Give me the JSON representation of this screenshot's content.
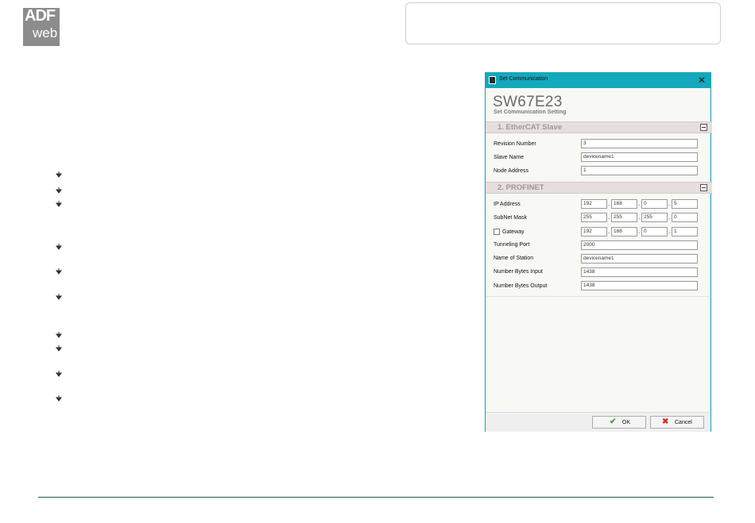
{
  "logo": {
    "line1": "ADF",
    "line2": "web"
  },
  "dialog": {
    "window_title": "Set Communication",
    "close_glyph": "✕",
    "heading": "SW67E23",
    "subheading": "Set Communication Setting",
    "sections": [
      {
        "label": "1. EtherCAT Slave",
        "toggle": "minus"
      },
      {
        "label": "2. PROFINET",
        "toggle": "minus"
      }
    ],
    "ethercat": {
      "revision_label": "Revision Number",
      "revision_value": "3",
      "slave_name_label": "Slave Name",
      "slave_name_value": "devicename1",
      "node_address_label": "Node Address",
      "node_address_value": "1"
    },
    "profinet": {
      "ip_label": "IP Address",
      "ip": [
        "192",
        "168",
        "0",
        "5"
      ],
      "subnet_label": "SubNet Mask",
      "subnet": [
        "255",
        "255",
        "255",
        "0"
      ],
      "gateway_label": "Gateway",
      "gateway_checked": false,
      "gateway": [
        "192",
        "168",
        "0",
        "1"
      ],
      "tunneling_label": "Tunneling Port",
      "tunneling_value": "2000",
      "station_label": "Name of Station",
      "station_value": "devicename1",
      "bytes_in_label": "Number Bytes Input",
      "bytes_in_value": "1438",
      "bytes_out_label": "Number Bytes Output",
      "bytes_out_value": "1438"
    },
    "ip_separator": ".",
    "ok_label": "OK",
    "cancel_label": "Cancel",
    "ok_icon": "checkmark-icon",
    "cancel_icon": "red-x-icon"
  },
  "colors": {
    "titlebar": "#13a9bb",
    "section_header": "#e7dede",
    "footer_line": "#1f5f55",
    "logo_bg": "#8c8c8c"
  },
  "bullet_icon": "arrow-bullet-icon"
}
